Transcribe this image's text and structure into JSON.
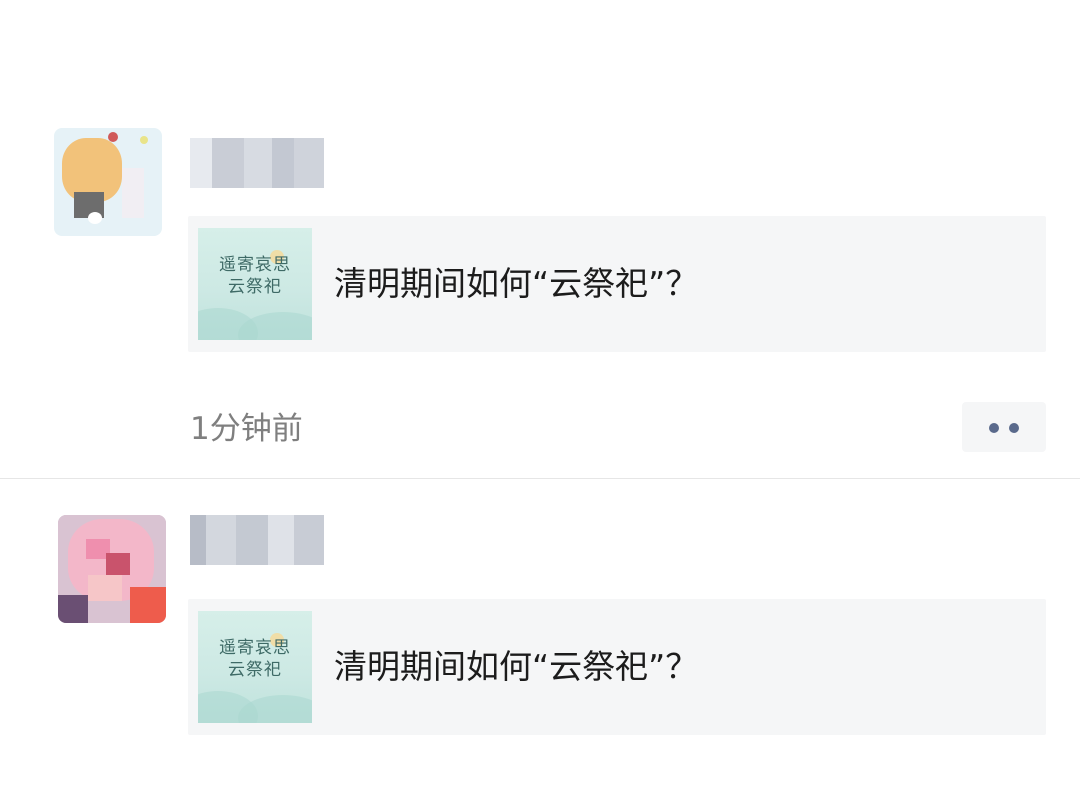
{
  "feed": {
    "posts": [
      {
        "share_card": {
          "thumbnail_text": [
            "遥寄哀思",
            "云祭祀"
          ],
          "title": "清明期间如何“云祭祀”？"
        },
        "timestamp": "1分钟前",
        "more_icon": "more-dots-icon"
      },
      {
        "share_card": {
          "thumbnail_text": [
            "遥寄哀思",
            "云祭祀"
          ],
          "title": "清明期间如何“云祭祀”？"
        }
      }
    ]
  },
  "colors": {
    "card_background": "#f5f6f7",
    "timestamp_text": "#7f7f7f",
    "more_dots": "#5a6a8c",
    "divider": "#e6e6e6"
  }
}
